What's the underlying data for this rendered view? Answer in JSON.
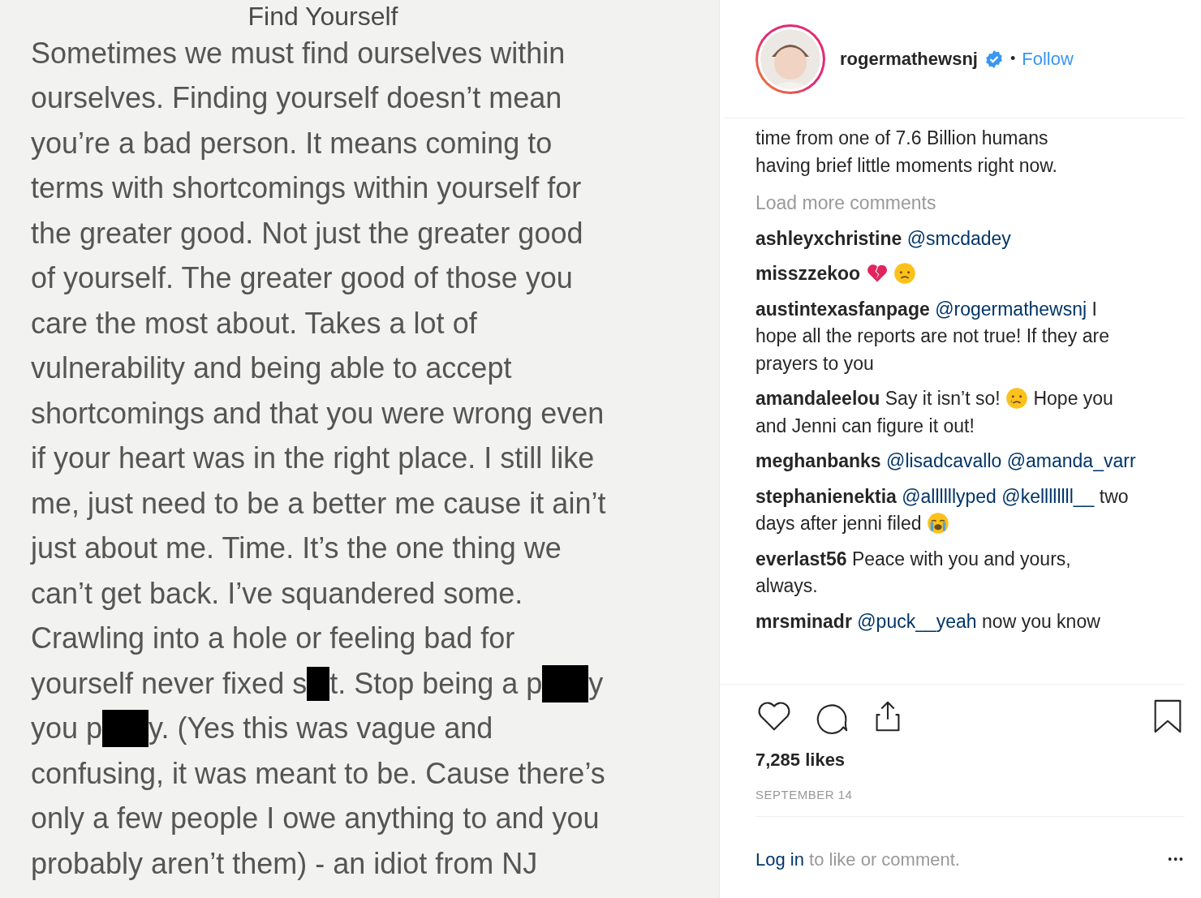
{
  "note": {
    "title": "Find Yourself",
    "lines": [
      [
        {
          "text": "Sometimes we must find ourselves within"
        }
      ],
      [
        {
          "text": "ourselves. Finding yourself doesn’t mean"
        }
      ],
      [
        {
          "text": "you’re a bad person. It means coming to"
        }
      ],
      [
        {
          "text": "terms with shortcomings within yourself for"
        }
      ],
      [
        {
          "text": "the greater good. Not just the greater good"
        }
      ],
      [
        {
          "text": "of yourself. The greater good of those you"
        }
      ],
      [
        {
          "text": "care the most about. Takes a lot of"
        }
      ],
      [
        {
          "text": "vulnerability and being able to accept"
        }
      ],
      [
        {
          "text": "shortcomings and that you were wrong even"
        }
      ],
      [
        {
          "text": "if your heart was in the right place. I still like"
        }
      ],
      [
        {
          "text": "me, just need to be a better me cause it ain’t"
        }
      ],
      [
        {
          "text": "just about me. Time. It’s the one thing we"
        }
      ],
      [
        {
          "text": "can’t get back. I’ve squandered some."
        }
      ],
      [
        {
          "text": "Crawling into a hole or feeling bad for"
        }
      ],
      [
        {
          "text": "yourself never fixed s"
        },
        {
          "kind": "redaction_narrow"
        },
        {
          "text": "t. Stop being a p"
        },
        {
          "kind": "redaction_wide"
        },
        {
          "text": "y"
        }
      ],
      [
        {
          "text": "you p"
        },
        {
          "kind": "redaction_wide"
        },
        {
          "text": "y. (Yes this was vague and"
        }
      ],
      [
        {
          "text": "confusing, it was meant to be. Cause there’s"
        }
      ],
      [
        {
          "text": "only a few people I owe anything to and you"
        }
      ],
      [
        {
          "text": "probably aren’t them) - an idiot from NJ"
        }
      ]
    ]
  },
  "header": {
    "username": "rogermathewsnj",
    "verified": true,
    "separator": "•",
    "follow": "Follow"
  },
  "caption_tail": "time from one of 7.6 Billion humans having brief little moments right now.",
  "load_more": "Load more comments",
  "comments": [
    {
      "user": "ashleyxchristine",
      "parts": [
        {
          "kind": "mention",
          "text": "@smcdadey"
        }
      ]
    },
    {
      "user": "misszzekoo",
      "parts": [
        {
          "kind": "broken_heart"
        },
        {
          "kind": "sad"
        }
      ]
    },
    {
      "user": "austintexasfanpage",
      "parts": [
        {
          "kind": "mention",
          "text": "@rogermathewsnj"
        },
        {
          "kind": "text",
          "text": "I hope all the reports are not true! If they are prayers to you"
        }
      ]
    },
    {
      "user": "amandaleelou",
      "parts": [
        {
          "kind": "text",
          "text": "Say it isn’t so!"
        },
        {
          "kind": "tear"
        },
        {
          "kind": "text",
          "text": "Hope you and Jenni can figure it out!"
        }
      ]
    },
    {
      "user": "meghanbanks",
      "parts": [
        {
          "kind": "mention",
          "text": "@lisadcavallo"
        },
        {
          "kind": "mention",
          "text": "@amanda_varr"
        }
      ]
    },
    {
      "user": "stephanienektia",
      "parts": [
        {
          "kind": "mention",
          "text": "@allllllyped"
        },
        {
          "kind": "mention",
          "text": "@kellllllll__"
        },
        {
          "kind": "text",
          "text": "two days after jenni filed"
        },
        {
          "kind": "crying"
        }
      ]
    },
    {
      "user": "everlast56",
      "parts": [
        {
          "kind": "text",
          "text": "Peace with you and yours, always."
        }
      ]
    },
    {
      "user": "mrsminadr",
      "parts": [
        {
          "kind": "mention",
          "text": "@puck__yeah"
        },
        {
          "kind": "text",
          "text": "now you know"
        }
      ]
    }
  ],
  "likes": "7,285 likes",
  "date": "SEPTEMBER 14",
  "login": {
    "link": "Log in",
    "rest": "to like or comment."
  },
  "more": "•••"
}
